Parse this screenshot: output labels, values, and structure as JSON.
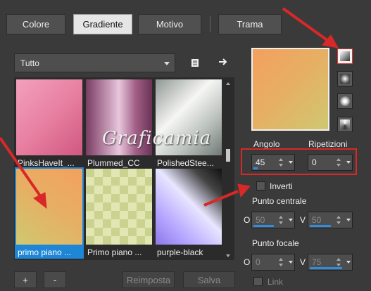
{
  "tabs": [
    {
      "label": "Colore",
      "active": false
    },
    {
      "label": "Gradiente",
      "active": true
    },
    {
      "label": "Motivo",
      "active": false
    },
    {
      "label": "Trama",
      "active": false
    }
  ],
  "category_dropdown": {
    "value": "Tutto",
    "icons": [
      "page-icon",
      "arrow-right-icon"
    ]
  },
  "gallery": [
    {
      "name": "PinksHaveIt_...",
      "colors": [
        "#f08fb0",
        "#d8688c"
      ],
      "selected": false
    },
    {
      "name": "Plummed_CC",
      "colors": [
        "#c79ab8",
        "#8a4d72"
      ],
      "selected": false
    },
    {
      "name": "PolishedStee...",
      "colors": [
        "#f2f2f0",
        "#9aa3a0"
      ],
      "selected": false
    },
    {
      "name": "primo piano ...",
      "colors": [
        "#f3a05e",
        "#cfc872"
      ],
      "selected": true
    },
    {
      "name": "Primo piano ...",
      "colors": [
        "#d9df9c",
        "#bfc987"
      ],
      "selected": false
    },
    {
      "name": "purple-black",
      "colors": [
        "#b6a6ff",
        "#111111"
      ],
      "selected": false
    }
  ],
  "watermark": "Graficamia",
  "buttons": {
    "add": "+",
    "remove": "-",
    "reset": "Reimposta",
    "save": "Salva"
  },
  "gradient_preview": {
    "colors": [
      "#f3a05e",
      "#cfc872"
    ]
  },
  "gradient_types": [
    "linear-icon",
    "rectangular-icon",
    "radial-icon",
    "sunburst-icon"
  ],
  "angle": {
    "label": "Angolo",
    "value": "45"
  },
  "repeats": {
    "label": "Ripetizioni",
    "value": "0"
  },
  "invert": {
    "label": "Inverti",
    "checked": false
  },
  "center_point": {
    "label": "Punto centrale",
    "h_label": "O",
    "h_value": "50",
    "v_label": "V",
    "v_value": "50"
  },
  "focal_point": {
    "label": "Punto focale",
    "h_label": "O",
    "h_value": "0",
    "v_label": "V",
    "v_value": "75"
  },
  "link": {
    "label": "Link",
    "checked": false
  },
  "annotation_color": "#d82828"
}
